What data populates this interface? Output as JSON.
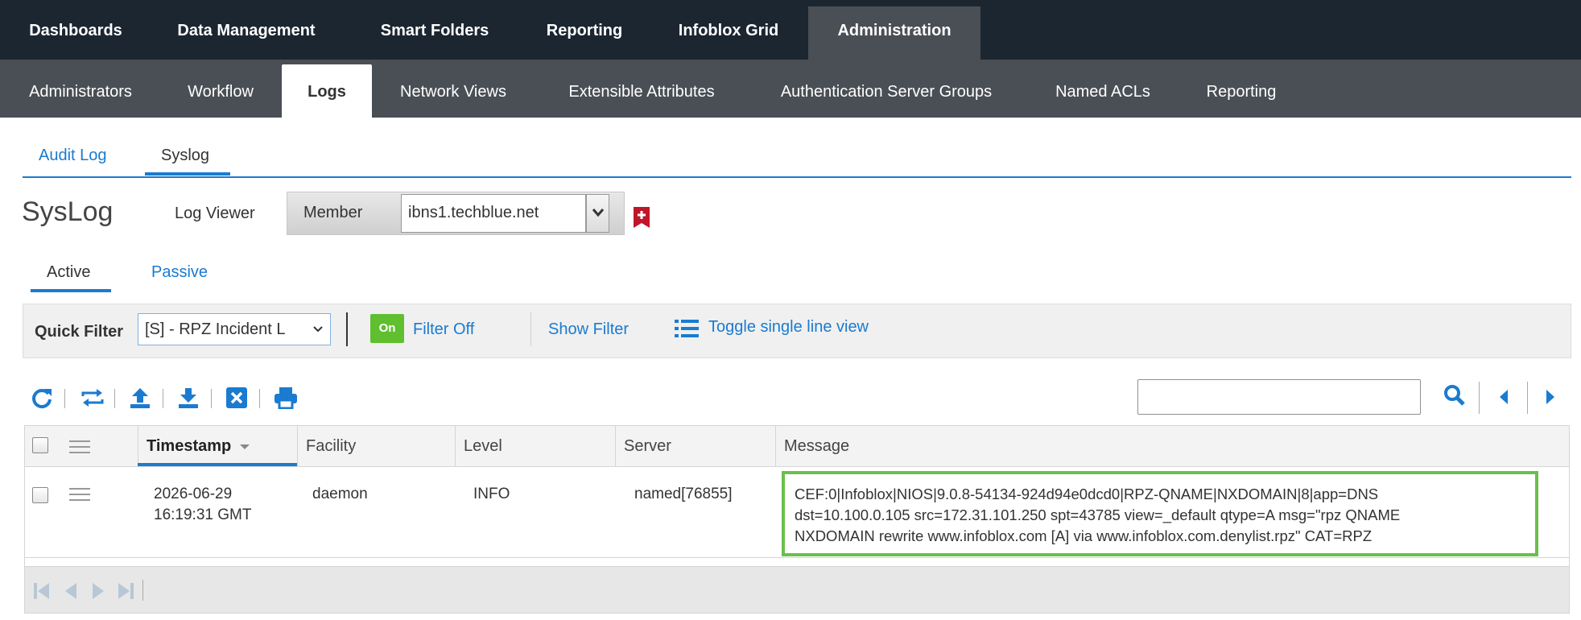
{
  "topnav": [
    {
      "label": "Dashboards",
      "active": false
    },
    {
      "label": "Data Management",
      "active": false
    },
    {
      "label": "Smart Folders",
      "active": false
    },
    {
      "label": "Reporting",
      "active": false
    },
    {
      "label": "Infoblox Grid",
      "active": false
    },
    {
      "label": "Administration",
      "active": true
    }
  ],
  "subnav": [
    {
      "label": "Administrators",
      "active": false
    },
    {
      "label": "Workflow",
      "active": false
    },
    {
      "label": "Logs",
      "active": true
    },
    {
      "label": "Network Views",
      "active": false
    },
    {
      "label": "Extensible Attributes",
      "active": false
    },
    {
      "label": "Authentication Server Groups",
      "active": false
    },
    {
      "label": "Named ACLs",
      "active": false
    },
    {
      "label": "Reporting",
      "active": false
    }
  ],
  "logtabs": [
    {
      "label": "Audit Log",
      "active": false
    },
    {
      "label": "Syslog",
      "active": true
    }
  ],
  "page_title": "SysLog",
  "log_viewer_label": "Log Viewer",
  "member": {
    "label": "Member",
    "value": "ibns1.techblue.net"
  },
  "mode_tabs": [
    {
      "label": "Active",
      "active": true
    },
    {
      "label": "Passive",
      "active": false
    }
  ],
  "filter": {
    "quick_filter_label": "Quick Filter",
    "quick_filter_value": "[S] - RPZ Incident L",
    "on_badge": "On",
    "filter_off": "Filter Off",
    "show_filter": "Show Filter",
    "toggle_single_line": "Toggle single line view"
  },
  "search": {
    "value": ""
  },
  "grid": {
    "columns": [
      "Timestamp",
      "Facility",
      "Level",
      "Server",
      "Message"
    ],
    "sorted_column": "Timestamp",
    "rows": [
      {
        "timestamp_date": "2026-06-29",
        "timestamp_time": "16:19:31 GMT",
        "facility": "daemon",
        "level": "INFO",
        "server": "named[76855]",
        "message_lines": [
          "CEF:0|Infoblox|NIOS|9.0.8-54134-924d94e0dcd0|RPZ-QNAME|NXDOMAIN|8|app=DNS",
          "dst=10.100.0.105 src=172.31.101.250 spt=43785 view=_default qtype=A msg=\"rpz QNAME",
          "NXDOMAIN rewrite www.infoblox.com [A] via www.infoblox.com.denylist.rpz\" CAT=RPZ"
        ]
      }
    ]
  },
  "colors": {
    "topnav_bg": "#1b2631",
    "subnav_bg": "#4a4f55",
    "link": "#1a7bd0",
    "on_badge": "#5fbf2f",
    "highlight_border": "#6abf4b",
    "bookmark": "#c0152a"
  }
}
